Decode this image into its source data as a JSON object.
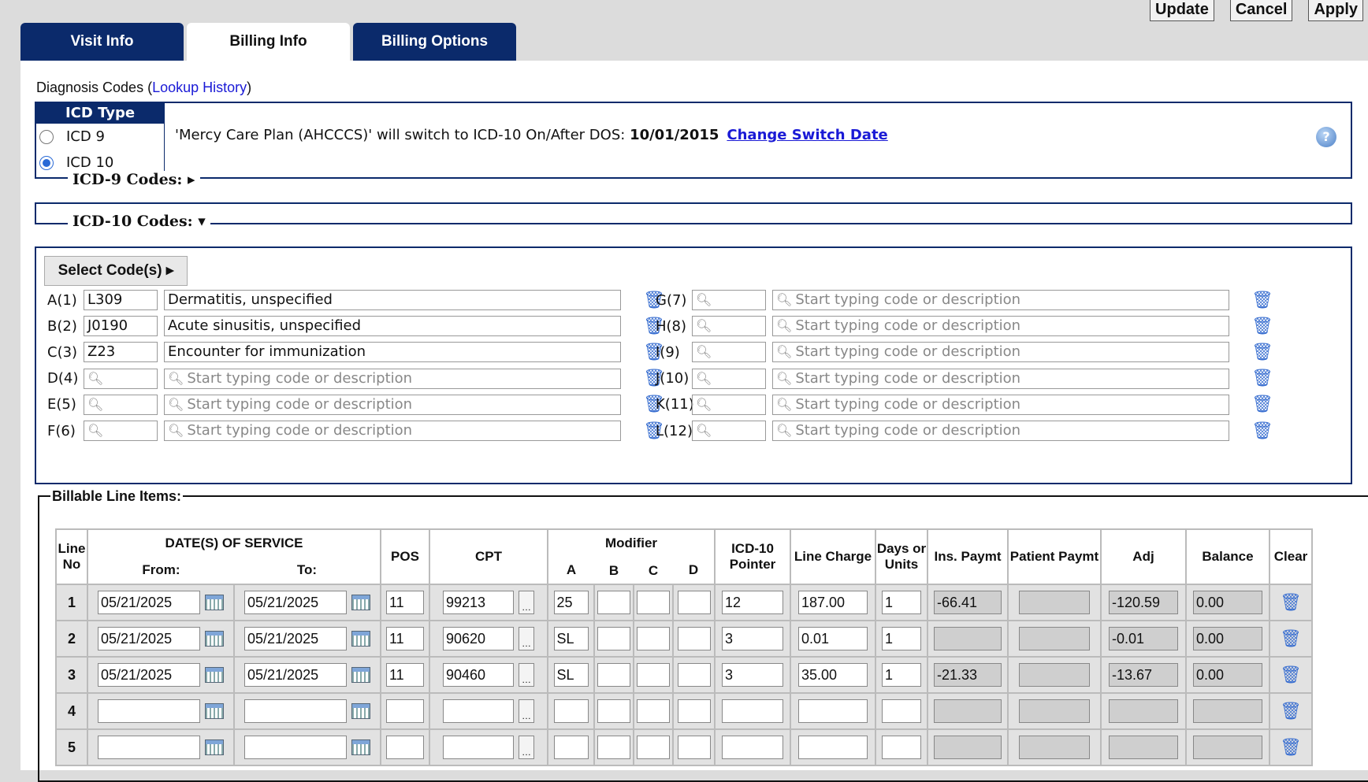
{
  "toolbar": {
    "update": "Update",
    "cancel": "Cancel",
    "apply": "Apply"
  },
  "tabs": [
    {
      "label": "Visit Info",
      "active": false
    },
    {
      "label": "Billing Info",
      "active": true
    },
    {
      "label": "Billing Options",
      "active": false
    }
  ],
  "diagnosis": {
    "title": "Diagnosis Codes (",
    "lookup_link": "Lookup History",
    "title_close": ")"
  },
  "icd_type": {
    "header": "ICD Type",
    "options": [
      {
        "label": "ICD 9",
        "selected": false
      },
      {
        "label": "ICD 10",
        "selected": true
      }
    ],
    "switch_msg": "'Mercy Care Plan (AHCCCS)' will switch to ICD-10 On/After DOS:",
    "switch_date": "10/01/2015",
    "change_link": "Change Switch Date"
  },
  "icd9": {
    "heading": "ICD-9 Codes: ▸"
  },
  "icd10": {
    "heading": "ICD-10 Codes: ▾",
    "select_button": "Select Code(s) ▸",
    "placeholder": "Start typing code or description",
    "left": [
      {
        "label": "A(1)",
        "code": "L309",
        "desc": "Dermatitis, unspecified"
      },
      {
        "label": "B(2)",
        "code": "J0190",
        "desc": "Acute sinusitis, unspecified"
      },
      {
        "label": "C(3)",
        "code": "Z23",
        "desc": "Encounter for immunization"
      },
      {
        "label": "D(4)",
        "code": "",
        "desc": ""
      },
      {
        "label": "E(5)",
        "code": "",
        "desc": ""
      },
      {
        "label": "F(6)",
        "code": "",
        "desc": ""
      }
    ],
    "right": [
      {
        "label": "G(7)",
        "code": "",
        "desc": ""
      },
      {
        "label": "H(8)",
        "code": "",
        "desc": ""
      },
      {
        "label": "I(9)",
        "code": "",
        "desc": ""
      },
      {
        "label": "J(10)",
        "code": "",
        "desc": ""
      },
      {
        "label": "K(11)",
        "code": "",
        "desc": ""
      },
      {
        "label": "L(12)",
        "code": "",
        "desc": ""
      }
    ]
  },
  "billable": {
    "legend": "Billable Line Items:",
    "headers": {
      "line_no": "Line No",
      "dates": "DATE(S) OF SERVICE",
      "from": "From:",
      "to": "To:",
      "pos": "POS",
      "cpt": "CPT",
      "modifier": "Modifier",
      "mod_a": "A",
      "mod_b": "B",
      "mod_c": "C",
      "mod_d": "D",
      "pointer": "ICD-10 Pointer",
      "charge": "Line Charge",
      "units": "Days or Units",
      "ins": "Ins. Paymt",
      "patient": "Patient Paymt",
      "adj": "Adj",
      "balance": "Balance",
      "clear": "Clear"
    },
    "rows": [
      {
        "no": "1",
        "from": "05/21/2025",
        "to": "05/21/2025",
        "pos": "11",
        "cpt": "99213",
        "a": "25",
        "b": "",
        "c": "",
        "d": "",
        "pointer": "12",
        "charge": "187.00",
        "units": "1",
        "ins": "-66.41",
        "patient": "",
        "adj": "-120.59",
        "balance": "0.00"
      },
      {
        "no": "2",
        "from": "05/21/2025",
        "to": "05/21/2025",
        "pos": "11",
        "cpt": "90620",
        "a": "SL",
        "b": "",
        "c": "",
        "d": "",
        "pointer": "3",
        "charge": "0.01",
        "units": "1",
        "ins": "",
        "patient": "",
        "adj": "-0.01",
        "balance": "0.00"
      },
      {
        "no": "3",
        "from": "05/21/2025",
        "to": "05/21/2025",
        "pos": "11",
        "cpt": "90460",
        "a": "SL",
        "b": "",
        "c": "",
        "d": "",
        "pointer": "3",
        "charge": "35.00",
        "units": "1",
        "ins": "-21.33",
        "patient": "",
        "adj": "-13.67",
        "balance": "0.00"
      },
      {
        "no": "4",
        "from": "",
        "to": "",
        "pos": "",
        "cpt": "",
        "a": "",
        "b": "",
        "c": "",
        "d": "",
        "pointer": "",
        "charge": "",
        "units": "",
        "ins": "",
        "patient": "",
        "adj": "",
        "balance": ""
      },
      {
        "no": "5",
        "from": "",
        "to": "",
        "pos": "",
        "cpt": "",
        "a": "",
        "b": "",
        "c": "",
        "d": "",
        "pointer": "",
        "charge": "",
        "units": "",
        "ins": "",
        "patient": "",
        "adj": "",
        "balance": ""
      }
    ]
  }
}
